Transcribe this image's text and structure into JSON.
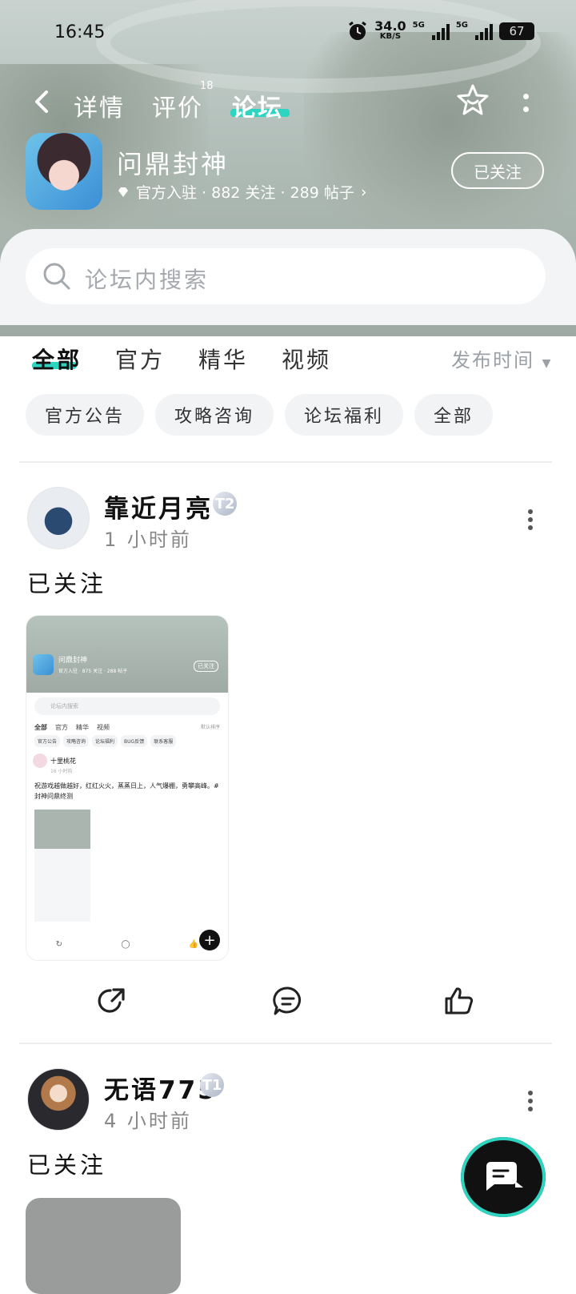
{
  "status_bar": {
    "time": "16:45",
    "net_speed": "34.0",
    "net_unit": "KB/S",
    "sig1_label": "5G",
    "sig2_label": "5G",
    "battery": "67"
  },
  "top_nav": {
    "tabs": [
      "详情",
      "评价",
      "论坛"
    ],
    "review_badge": "18",
    "active_tab": "论坛"
  },
  "app": {
    "name": "问鼎封神",
    "meta": "官方入驻 · 882 关注 · 289 帖子",
    "follow_label": "已关注"
  },
  "search": {
    "placeholder": "论坛内搜索"
  },
  "main_tabs": [
    "全部",
    "官方",
    "精华",
    "视频"
  ],
  "sort_label": "发布时间",
  "chips": [
    "官方公告",
    "攻略咨询",
    "论坛福利",
    "全部"
  ],
  "posts": [
    {
      "user": "靠近月亮",
      "level": "T2",
      "time": "1 小时前",
      "text": "已关注"
    },
    {
      "user": "无语775",
      "level": "T1",
      "time": "4 小时前",
      "text": "已关注"
    }
  ],
  "screenshot_preview": {
    "app_name": "问鼎封神",
    "meta": "官方入驻 · 875 关注 · 288 帖子",
    "follow": "已关注",
    "search": "论坛内搜索",
    "tabs": [
      "全部",
      "官方",
      "精华",
      "视频"
    ],
    "sort": "默认排序",
    "chips": [
      "官方公告",
      "攻略咨询",
      "论坛福利",
      "BUG反馈",
      "联系客服"
    ],
    "user": "十里桃花",
    "time": "16 小时前",
    "text": "祝游戏越做越好，红红火火，蒸蒸日上，人气爆棚，勇攀高峰。#封神问鼎终测"
  },
  "colors": {
    "accent": "#2dd4bf",
    "chip_bg": "#f2f3f5"
  }
}
